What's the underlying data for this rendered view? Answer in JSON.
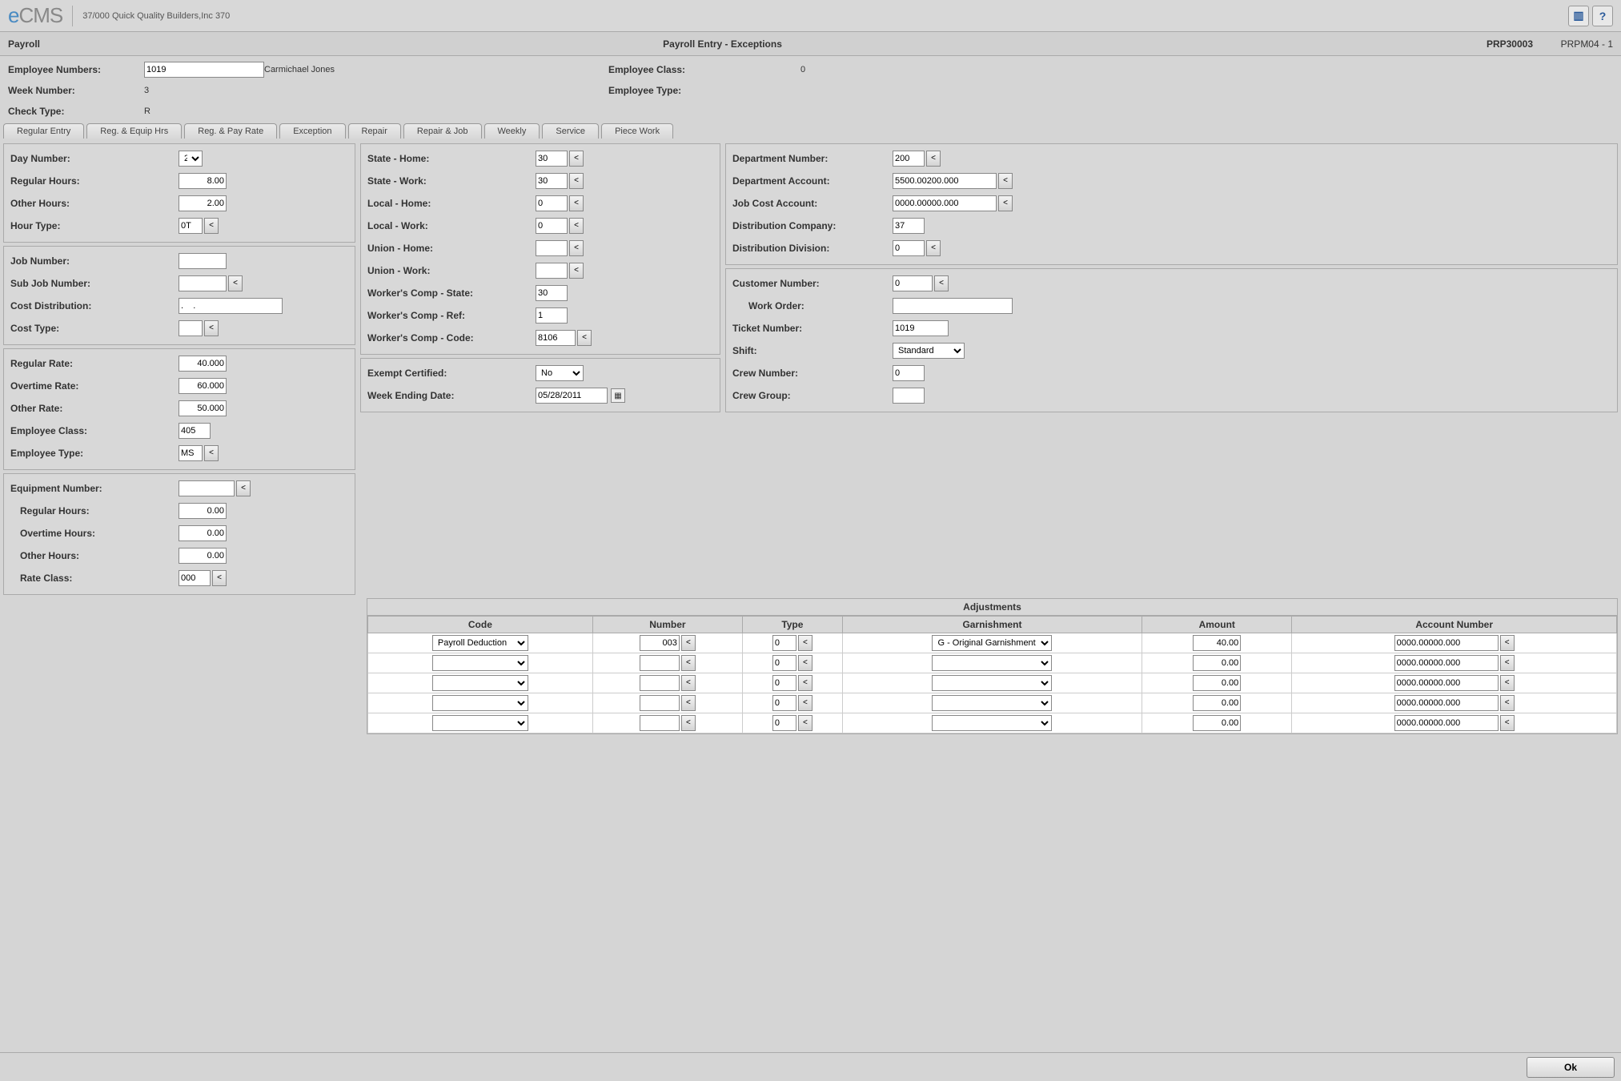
{
  "app": {
    "logo_e": "e",
    "logo_rest": "CMS",
    "company": "37/000   Quick Quality Builders,Inc 370"
  },
  "page": {
    "module": "Payroll",
    "title": "Payroll Entry - Exceptions",
    "code": "PRP30003",
    "screen": "PRPM04 - 1"
  },
  "header": {
    "emp_num_label": "Employee Numbers:",
    "emp_num": "1019",
    "emp_name": "Carmichael Jones",
    "emp_class_label": "Employee Class:",
    "emp_class": "0",
    "week_label": "Week Number:",
    "week": "3",
    "emp_type_label": "Employee Type:",
    "emp_type": "",
    "check_label": "Check Type:",
    "check": "R"
  },
  "tabs": [
    "Regular Entry",
    "Reg. & Equip Hrs",
    "Reg. & Pay Rate",
    "Exception",
    "Repair",
    "Repair & Job",
    "Weekly",
    "Service",
    "Piece Work"
  ],
  "left1": {
    "day_label": "Day Number:",
    "day": "2",
    "reg_label": "Regular Hours:",
    "reg": "8.00",
    "other_label": "Other Hours:",
    "other": "2.00",
    "htype_label": "Hour Type:",
    "htype": "0T"
  },
  "left2": {
    "job_label": "Job Number:",
    "job": "",
    "sub_label": "Sub Job Number:",
    "sub": "",
    "dist_label": "Cost Distribution:",
    "dist": ".    .",
    "ctype_label": "Cost Type:",
    "ctype": ""
  },
  "left3": {
    "rr_label": "Regular Rate:",
    "rr": "40.000",
    "ot_label": "Overtime Rate:",
    "ot": "60.000",
    "or_label": "Other Rate:",
    "or": "50.000",
    "ec_label": "Employee Class:",
    "ec": "405",
    "et_label": "Employee Type:",
    "et": "MS"
  },
  "left4": {
    "eq_label": "Equipment Number:",
    "eq": "",
    "rh_label": "Regular Hours:",
    "rh": "0.00",
    "oh_label": "Overtime Hours:",
    "oh": "0.00",
    "oth_label": "Other Hours:",
    "oth": "0.00",
    "rc_label": "Rate Class:",
    "rc": "000"
  },
  "mid1": {
    "sh_label": "State - Home:",
    "sh": "30",
    "sw_label": "State - Work:",
    "sw": "30",
    "lh_label": "Local - Home:",
    "lh": "0",
    "lw_label": "Local - Work:",
    "lw": "0",
    "uh_label": "Union - Home:",
    "uh": "",
    "uw_label": "Union - Work:",
    "uw": "",
    "wcs_label": "Worker's Comp - State:",
    "wcs": "30",
    "wcr_label": "Worker's Comp - Ref:",
    "wcr": "1",
    "wcc_label": "Worker's Comp - Code:",
    "wcc": "8106"
  },
  "mid2": {
    "ex_label": "Exempt Certified:",
    "ex": "No",
    "wed_label": "Week Ending Date:",
    "wed": "05/28/2011"
  },
  "right1": {
    "dn_label": "Department Number:",
    "dn": "200",
    "da_label": "Department Account:",
    "da": "5500.00200.000",
    "jca_label": "Job Cost Account:",
    "jca": "0000.00000.000",
    "dc_label": "Distribution Company:",
    "dc": "37",
    "dd_label": "Distribution Division:",
    "dd": "0"
  },
  "right2": {
    "cn_label": "Customer Number:",
    "cn": "0",
    "wo_label": "Work Order:",
    "wo": "",
    "tn_label": "Ticket Number:",
    "tn": "1019",
    "sh_label": "Shift:",
    "sh": "Standard",
    "crn_label": "Crew Number:",
    "crn": "0",
    "crg_label": "Crew Group:",
    "crg": ""
  },
  "adj": {
    "title": "Adjustments",
    "headers": [
      "Code",
      "Number",
      "Type",
      "Garnishment",
      "Amount",
      "Account Number"
    ],
    "rows": [
      {
        "code": "Payroll Deduction",
        "num": "003",
        "type": "0",
        "garn": "G - Original Garnishment",
        "amt": "40.00",
        "acct": "0000.00000.000"
      },
      {
        "code": "",
        "num": "",
        "type": "0",
        "garn": "",
        "amt": "0.00",
        "acct": "0000.00000.000"
      },
      {
        "code": "",
        "num": "",
        "type": "0",
        "garn": "",
        "amt": "0.00",
        "acct": "0000.00000.000"
      },
      {
        "code": "",
        "num": "",
        "type": "0",
        "garn": "",
        "amt": "0.00",
        "acct": "0000.00000.000"
      },
      {
        "code": "",
        "num": "",
        "type": "0",
        "garn": "",
        "amt": "0.00",
        "acct": "0000.00000.000"
      }
    ]
  },
  "buttons": {
    "ok": "Ok",
    "lookup": "<"
  }
}
